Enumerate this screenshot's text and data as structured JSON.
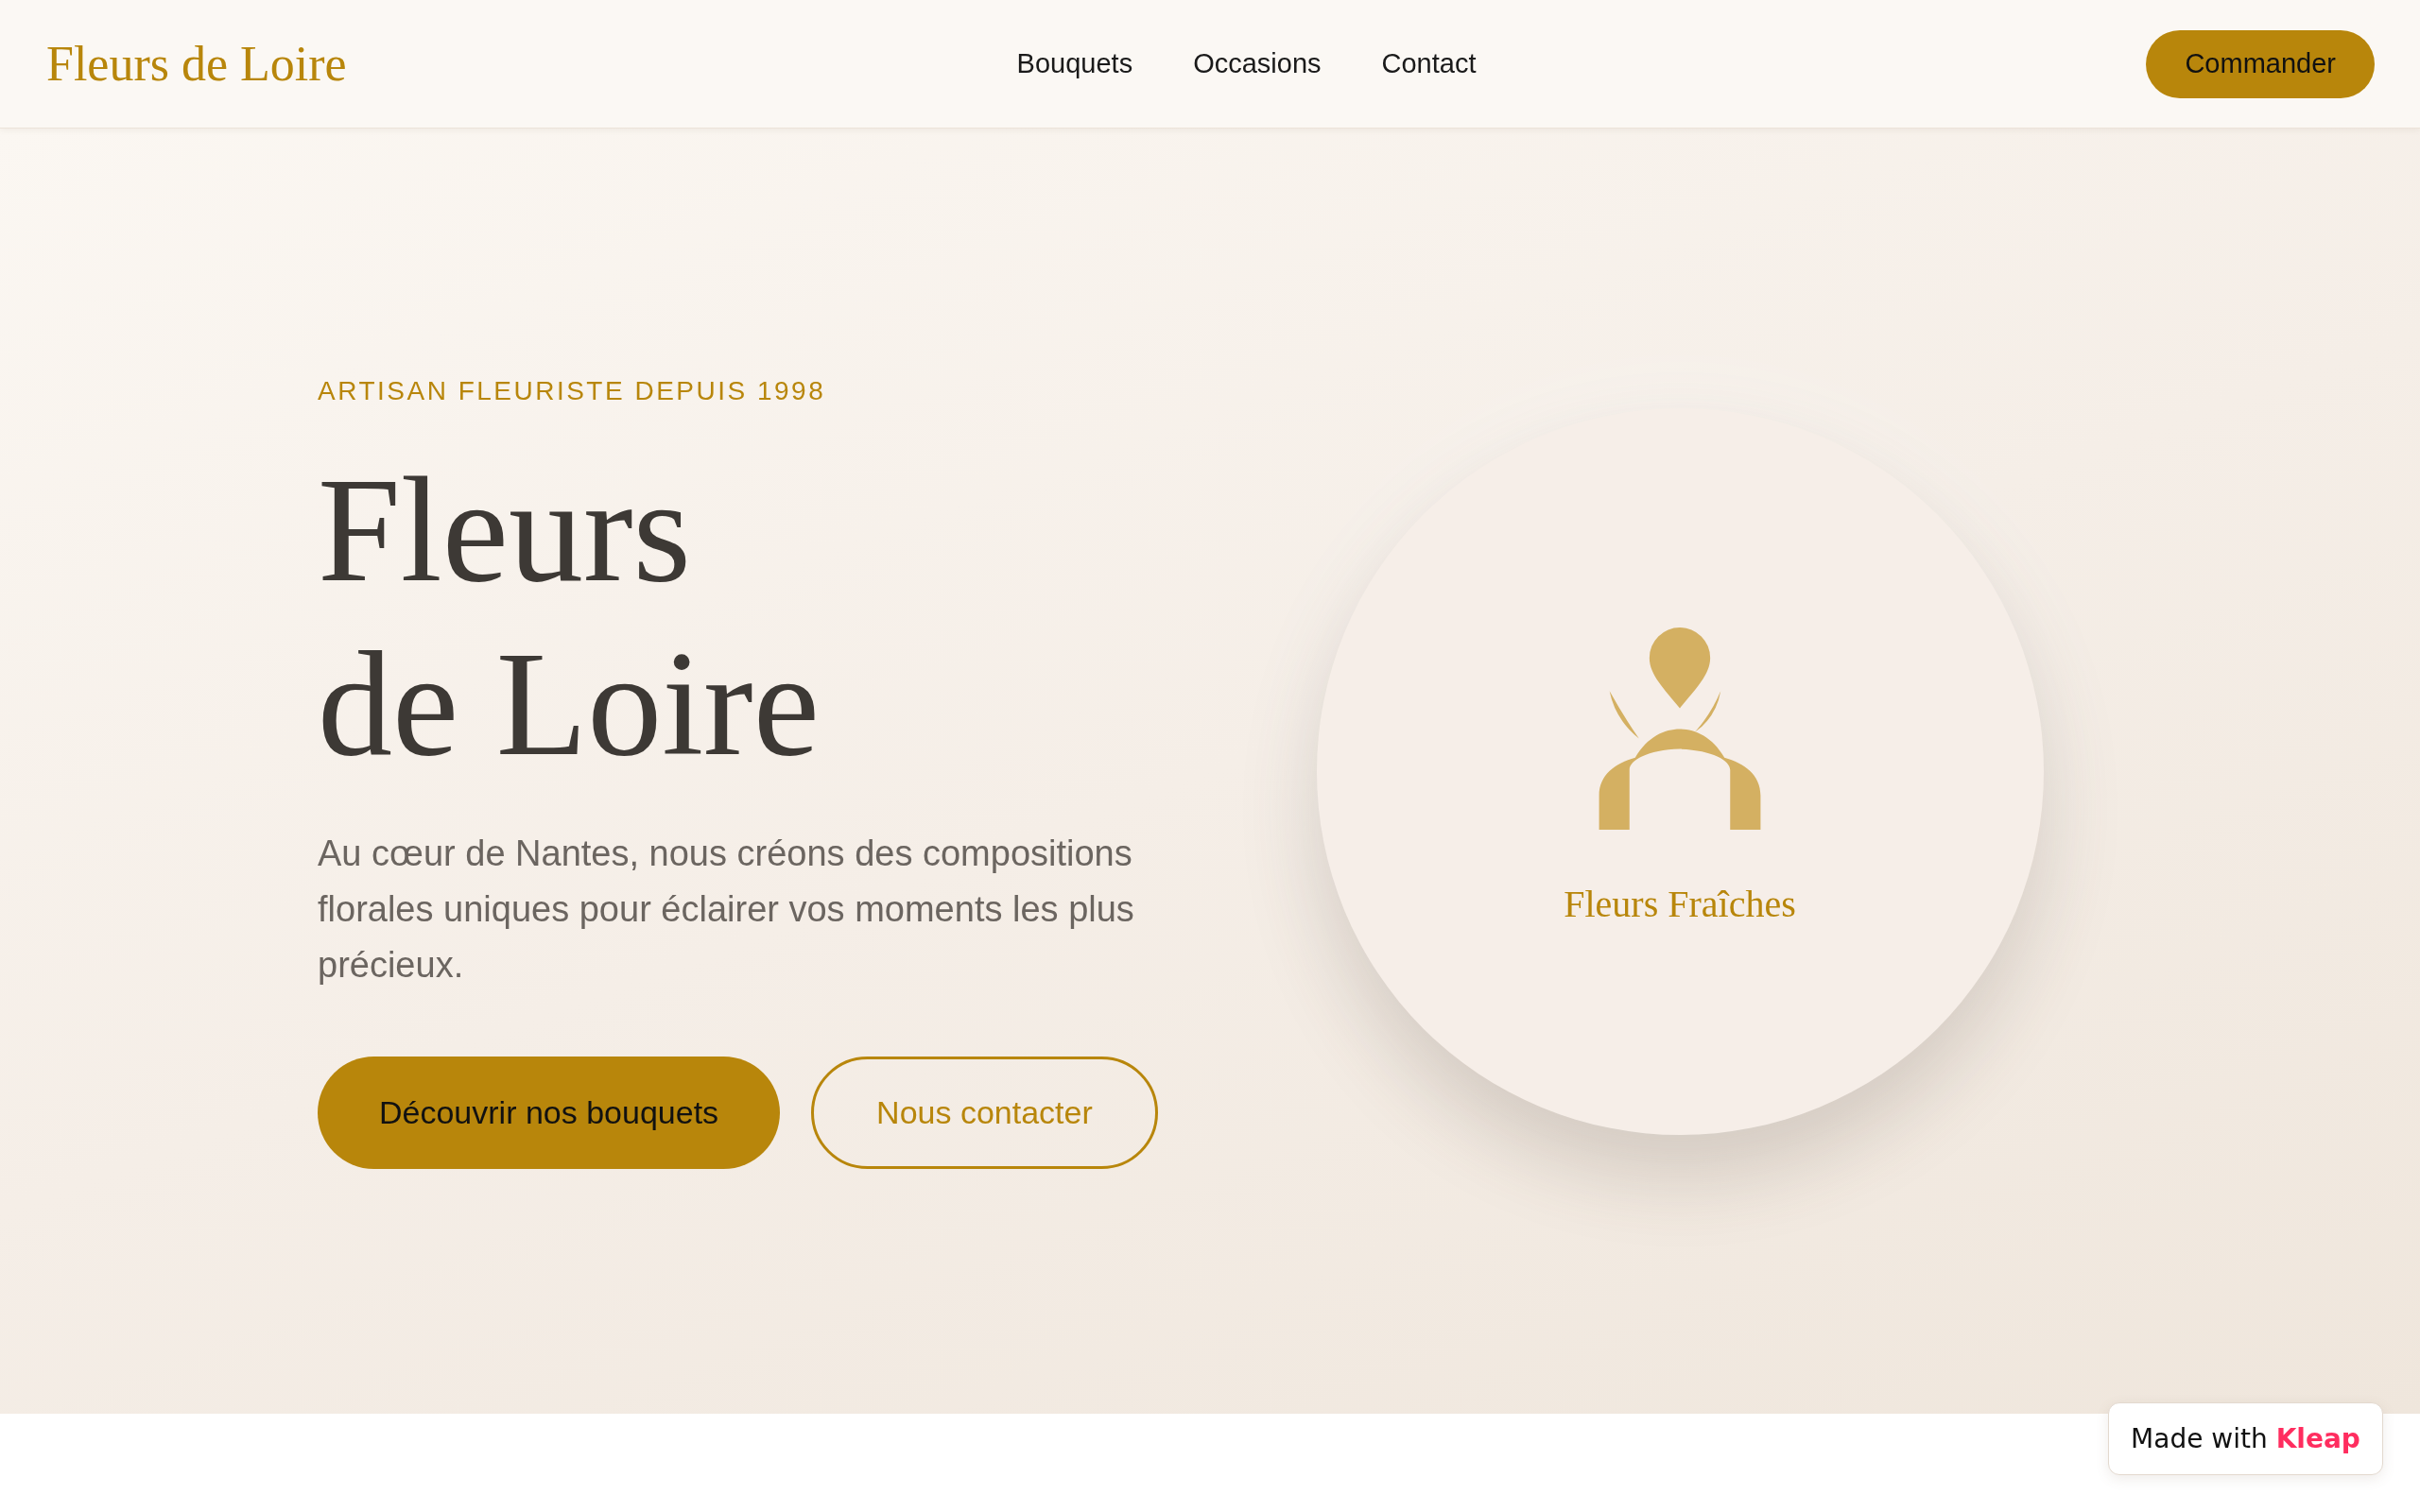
{
  "header": {
    "logo": "Fleurs de Loire",
    "nav": [
      "Bouquets",
      "Occasions",
      "Contact"
    ],
    "cta": "Commander"
  },
  "hero": {
    "eyebrow": "ARTISAN FLEURISTE DEPUIS 1998",
    "title_lines": [
      "Fleurs",
      "de Loire"
    ],
    "description": "Au cœur de Nantes, nous créons des compositions florales uniques pour éclairer vos moments les plus précieux.",
    "buttons": [
      {
        "label": "Découvrir nos bouquets",
        "kind": "primary"
      },
      {
        "label": "Nous contacter",
        "kind": "outline"
      }
    ],
    "feature": {
      "caption": "Fleurs Fraîches"
    }
  },
  "badge": {
    "text": "Made with **Kleap**"
  }
}
